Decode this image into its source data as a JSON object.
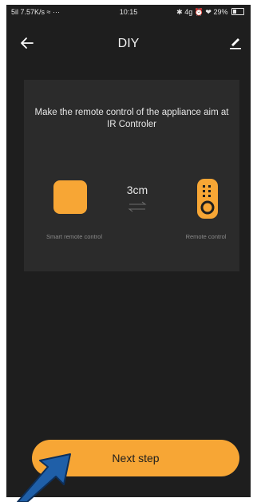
{
  "status_bar": {
    "left": "5il 7.57K/s ≈ ···",
    "time": "10:15",
    "right": "✱ 4g ⏰ ❤ 29%"
  },
  "header": {
    "title": "DIY",
    "back_icon": "arrow-left-icon",
    "edit_icon": "pencil-icon"
  },
  "card": {
    "instruction": "Make the remote control of the appliance aim at IR Controler",
    "distance": "3cm",
    "left_label": "Smart remote control",
    "right_label": "Remote control"
  },
  "footer": {
    "next_label": "Next step"
  },
  "colors": {
    "accent": "#f7a635",
    "background": "#1e1e1e",
    "card": "#2b2b2b",
    "pointer": "#1f5fa8"
  }
}
